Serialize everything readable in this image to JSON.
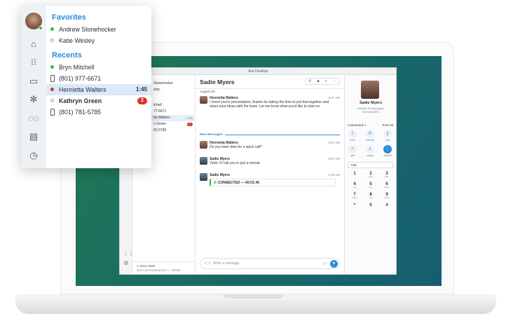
{
  "popup": {
    "favorites_heading": "Favorites",
    "favorites": [
      {
        "name": "Andrew Stonehocker",
        "status": "online"
      },
      {
        "name": "Katie Wesley",
        "status": "offline"
      }
    ],
    "recents_heading": "Recents",
    "recents": [
      {
        "name": "Bryn Mitchell",
        "status": "online"
      },
      {
        "name": "(801) 977-6671",
        "status": "phone"
      },
      {
        "name": "Henrietta Walters",
        "status": "busy",
        "time": "1:45"
      },
      {
        "name": "Kathryn Green",
        "status": "offline",
        "badge": "2"
      },
      {
        "name": "(801) 781-5785",
        "status": "phone"
      }
    ],
    "rail_icons": [
      "home-icon",
      "dialpad-icon",
      "chat-icon",
      "snowflake-icon",
      "voicemail-icon",
      "contacts-icon",
      "history-icon"
    ]
  },
  "app": {
    "window_title": "Jive Desktop",
    "list": {
      "items": [
        "Stonehocker",
        "sley",
        "",
        "tchell",
        "77-6671",
        "tta Walters",
        "n Green",
        "81-5785"
      ],
      "selected_time": "1:45",
      "badge": "2",
      "footer_line1": "Cisco 9104",
      "footer_line2": "Jive Communications — #9328"
    },
    "chat": {
      "title": "Sadie Myers",
      "date_label": "August 23",
      "new_messages_label": "New Messages",
      "composer_placeholder": "Write a message",
      "messages": [
        {
          "name": "Henrietta Walters",
          "time": "9:37 AM",
          "text": "I loved you're presentation, thanks for taking the time to put that together and share your ideas with the team. Let me know what you'd like to start on."
        },
        {
          "name": "Henrietta Walters",
          "time": "9:37 AM",
          "text": "Do you have time for a quick call?"
        },
        {
          "name": "Sadie Myers",
          "time": "9:37 AM",
          "text": "Yeah, I'll call you in just a minute."
        },
        {
          "name": "Sadie Myers",
          "time": "9:39 AM",
          "text": ""
        }
      ],
      "call_event": "CONNECTED — 00:01:45"
    },
    "call_panel": {
      "name": "Sadie Myers",
      "company": "Novatic Technologies",
      "local_time": "9:25 AM MST",
      "status": "Connected",
      "timer": "0:01:45",
      "controls": [
        "mute",
        "transfer",
        "hold",
        "add",
        "merge",
        "dialpad"
      ],
      "dial_value": "645",
      "keys": [
        {
          "d": "1",
          "l": ""
        },
        {
          "d": "2",
          "l": "ABC"
        },
        {
          "d": "3",
          "l": "DEF"
        },
        {
          "d": "4",
          "l": "GHI"
        },
        {
          "d": "5",
          "l": "JKL"
        },
        {
          "d": "6",
          "l": "MNO"
        },
        {
          "d": "7",
          "l": "PQRS"
        },
        {
          "d": "8",
          "l": "TUV"
        },
        {
          "d": "9",
          "l": "WXYZ"
        },
        {
          "d": "*",
          "l": ""
        },
        {
          "d": "0",
          "l": ""
        },
        {
          "d": "#",
          "l": ""
        }
      ]
    }
  },
  "colors": {
    "accent": "#2d8ad8",
    "online": "#3bb54a",
    "busy": "#d8342c",
    "screen_green": "#1e7a52",
    "screen_teal": "#155e72"
  }
}
